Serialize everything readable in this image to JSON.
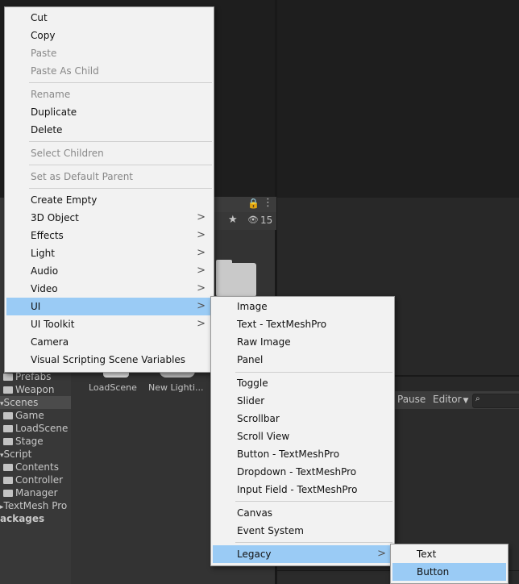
{
  "context_menu": {
    "items": [
      {
        "label": "Cut",
        "enabled": true
      },
      {
        "label": "Copy",
        "enabled": true
      },
      {
        "label": "Paste",
        "enabled": false
      },
      {
        "label": "Paste As Child",
        "enabled": false
      },
      {
        "label": "Rename",
        "enabled": false
      },
      {
        "label": "Duplicate",
        "enabled": true
      },
      {
        "label": "Delete",
        "enabled": true
      },
      {
        "label": "Select Children",
        "enabled": false
      },
      {
        "label": "Set as Default Parent",
        "enabled": false
      },
      {
        "label": "Create Empty",
        "enabled": true
      },
      {
        "label": "3D Object",
        "enabled": true,
        "submenu": true
      },
      {
        "label": "Effects",
        "enabled": true,
        "submenu": true
      },
      {
        "label": "Light",
        "enabled": true,
        "submenu": true
      },
      {
        "label": "Audio",
        "enabled": true,
        "submenu": true
      },
      {
        "label": "Video",
        "enabled": true,
        "submenu": true
      },
      {
        "label": "UI",
        "enabled": true,
        "submenu": true,
        "highlighted": true
      },
      {
        "label": "UI Toolkit",
        "enabled": true,
        "submenu": true
      },
      {
        "label": "Camera",
        "enabled": true
      },
      {
        "label": "Visual Scripting Scene Variables",
        "enabled": true
      }
    ]
  },
  "ui_submenu": {
    "items": [
      {
        "label": "Image"
      },
      {
        "label": "Text - TextMeshPro"
      },
      {
        "label": "Raw Image"
      },
      {
        "label": "Panel"
      },
      {
        "label": "Toggle"
      },
      {
        "label": "Slider"
      },
      {
        "label": "Scrollbar"
      },
      {
        "label": "Scroll View"
      },
      {
        "label": "Button - TextMeshPro"
      },
      {
        "label": "Dropdown - TextMeshPro"
      },
      {
        "label": "Input Field - TextMeshPro"
      },
      {
        "label": "Canvas"
      },
      {
        "label": "Event System"
      },
      {
        "label": "Legacy",
        "submenu": true,
        "highlighted": true
      }
    ]
  },
  "legacy_submenu": {
    "items": [
      {
        "label": "Text"
      },
      {
        "label": "Button",
        "highlighted": true
      }
    ]
  },
  "project_tree": {
    "items": [
      "Prefabs",
      "Weapon",
      "Scenes",
      "Game",
      "LoadScene",
      "Stage",
      "Script",
      "Contents",
      "Controller",
      "Manager",
      "TextMesh Pro",
      "ackages"
    ]
  },
  "project_assets": {
    "load_scene": "LoadScene",
    "new_lighting": "New Lighti..."
  },
  "project_toolbar": {
    "hidden_count": "15"
  },
  "game_toolbar": {
    "pause_label": "Pause",
    "editor_label": "Editor"
  },
  "menu_glyphs": {
    "submenu_arrow": ">"
  },
  "colors": {
    "highlight": "#9acbf5",
    "menu_bg": "#f2f2f2",
    "editor_bg": "#282828"
  }
}
